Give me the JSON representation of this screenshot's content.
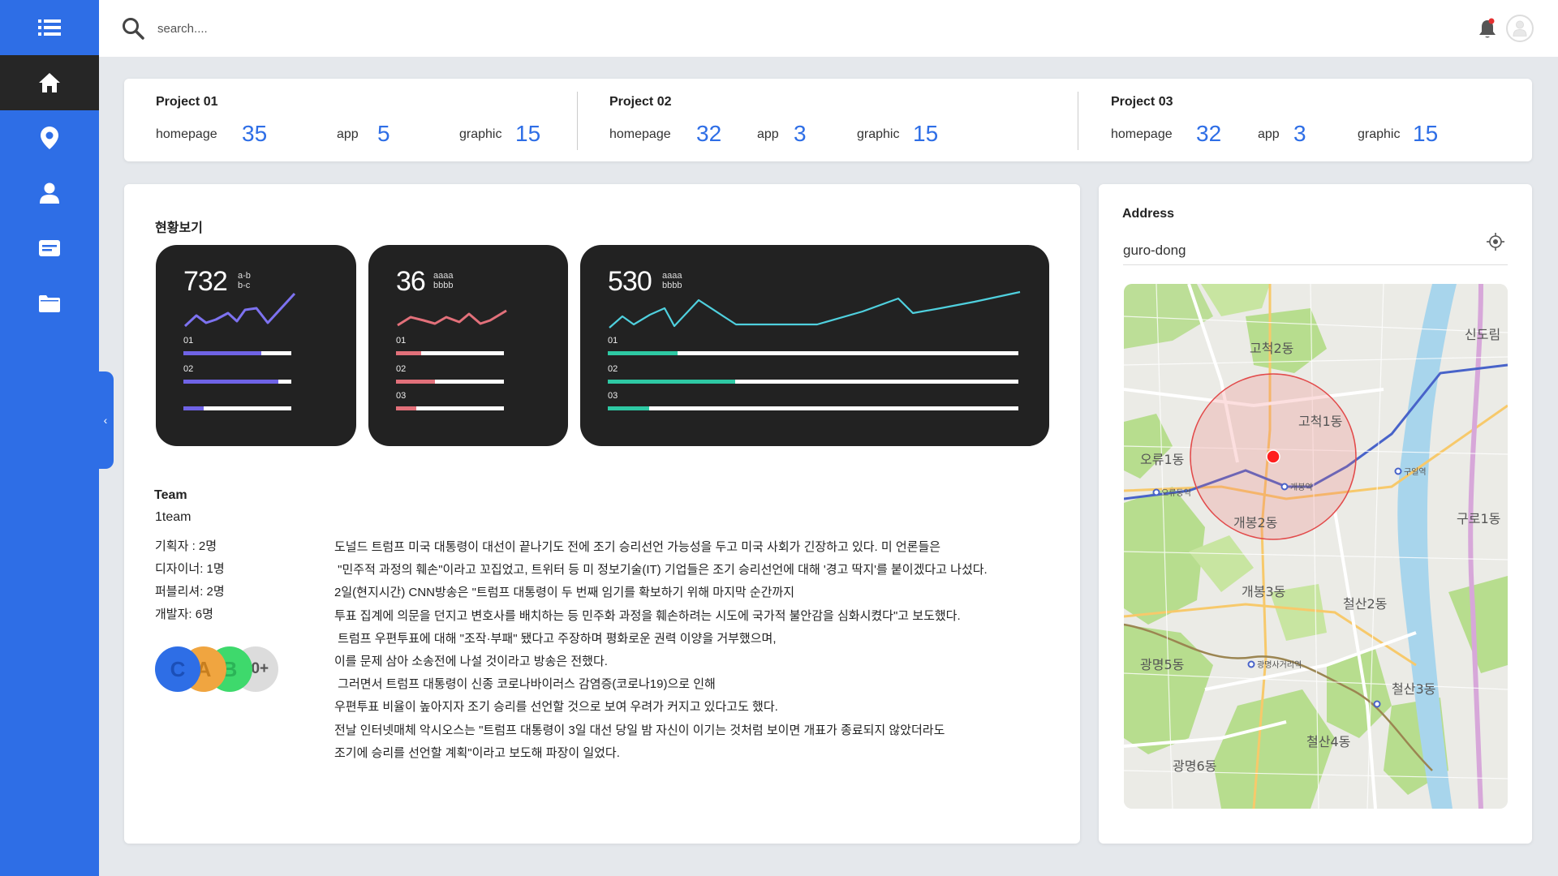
{
  "header": {
    "search_placeholder": "search...."
  },
  "sidebar": {
    "items": [
      {
        "name": "menu",
        "icon": "list-icon"
      },
      {
        "name": "home",
        "icon": "home-icon",
        "active": true
      },
      {
        "name": "location",
        "icon": "location-pin-icon"
      },
      {
        "name": "user",
        "icon": "user-icon"
      },
      {
        "name": "message",
        "icon": "message-icon"
      },
      {
        "name": "folder",
        "icon": "folder-icon"
      }
    ],
    "toggle_glyph": "‹"
  },
  "projects": [
    {
      "title": "Project 01",
      "stats": [
        {
          "label": "homepage",
          "value": "35"
        },
        {
          "label": "app",
          "value": "5"
        },
        {
          "label": "graphic",
          "value": "15"
        }
      ]
    },
    {
      "title": "Project 02",
      "stats": [
        {
          "label": "homepage",
          "value": "32"
        },
        {
          "label": "app",
          "value": "3"
        },
        {
          "label": "graphic",
          "value": "15"
        }
      ]
    },
    {
      "title": "Project 03",
      "stats": [
        {
          "label": "homepage",
          "value": "32"
        },
        {
          "label": "app",
          "value": "3"
        },
        {
          "label": "graphic",
          "value": "15"
        }
      ]
    }
  ],
  "overview": {
    "title": "현황보기",
    "cards": [
      {
        "value": "732",
        "sub1": "a-b",
        "sub2": "b-c",
        "color": "#6f63e6",
        "bars": [
          {
            "label": "01",
            "fill": 0.72
          },
          {
            "label": "02",
            "fill": 0.88
          },
          {
            "label": "",
            "fill": 0.19
          }
        ]
      },
      {
        "value": "36",
        "sub1": "aaaa",
        "sub2": "bbbb",
        "color": "#e2707a",
        "bars": [
          {
            "label": "01",
            "fill": 0.23
          },
          {
            "label": "02",
            "fill": 0.36
          },
          {
            "label": "03",
            "fill": 0.19
          }
        ]
      },
      {
        "value": "530",
        "sub1": "aaaa",
        "sub2": "bbbb",
        "color": "#2ec9a4",
        "bars": [
          {
            "label": "01",
            "fill": 0.17
          },
          {
            "label": "02",
            "fill": 0.31
          },
          {
            "label": "03",
            "fill": 0.1
          }
        ]
      }
    ]
  },
  "team": {
    "title": "Team",
    "name": "1team",
    "roles": [
      "기획자 : 2명",
      "디자이너: 1명",
      "퍼블리셔: 2명",
      "개발자: 6명"
    ],
    "members": [
      {
        "initial": "C",
        "color": "#2e6ee6"
      },
      {
        "initial": "A",
        "color": "#f0a540"
      },
      {
        "initial": "B",
        "color": "#3ed96c"
      }
    ],
    "more": "30+"
  },
  "news": [
    "도널드 트럼프 미국 대통령이 대선이 끝나기도 전에 조기 승리선언 가능성을 두고 미국 사회가 긴장하고 있다. 미 언론들은",
    " \"민주적 과정의 훼손\"이라고 꼬집었고, 트위터 등 미 정보기술(IT) 기업들은 조기 승리선언에 대해 '경고 딱지'를 붙이겠다고 나섰다.",
    "2일(현지시간) CNN방송은 \"트럼프 대통령이 두 번째 임기를 확보하기 위해 마지막 순간까지",
    "투표 집계에 의문을 던지고 변호사를 배치하는 등 민주화 과정을 훼손하려는 시도에 국가적 불안감을 심화시켰다\"고 보도했다.",
    " 트럼프 우편투표에 대해 \"조작·부패\" 됐다고 주장하며 평화로운 권력 이양을 거부했으며,",
    "이를 문제 삼아 소송전에 나설 것이라고 방송은 전했다.",
    " 그러면서 트럼프 대통령이 신종 코로나바이러스 감염증(코로나19)으로 인해",
    "우편투표 비율이 높아지자 조기 승리를 선언할 것으로 보여 우려가 커지고 있다고도 했다.",
    "전날 인터넷매체 악시오스는 \"트럼프 대통령이 3일 대선 당일 밤 자신이 이기는 것처럼 보이면 개표가 종료되지 않았더라도",
    "조기에 승리를 선언할 계획\"이라고 보도해 파장이 일었다."
  ],
  "address": {
    "title": "Address",
    "value": "guro-dong",
    "map_labels": [
      "고척1동",
      "고척2동",
      "오류1동",
      "개봉2동",
      "개봉3동",
      "구로1동",
      "철산2동",
      "광명5동",
      "광명6동",
      "철산4동",
      "철산3동",
      "신도림",
      "구일역",
      "개봉역",
      "오류동역",
      "광명사거리역"
    ]
  }
}
